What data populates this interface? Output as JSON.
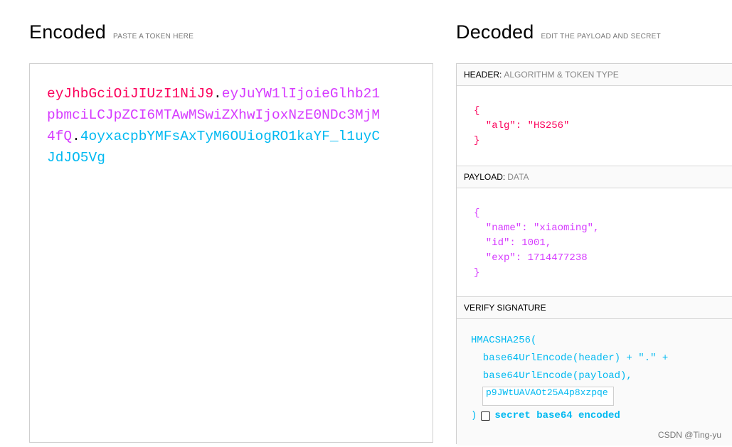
{
  "encoded": {
    "title": "Encoded",
    "subtitle": "PASTE A TOKEN HERE",
    "token": {
      "header": "eyJhbGciOiJIUzI1NiJ9",
      "payload": "eyJuYW1lIjoieGlhb21pbmciLCJpZCI6MTAwMSwiZXhwIjoxNzE0NDc3MjM4fQ",
      "signature": "4oyxacpbYMFsAxTyM6OUiogRO1kaYF_l1uyCJdJO5Vg",
      "dot": "."
    }
  },
  "decoded": {
    "title": "Decoded",
    "subtitle": "EDIT THE PAYLOAD AND SECRET",
    "header_section": {
      "label": "HEADER:",
      "sublabel": "ALGORITHM & TOKEN TYPE",
      "lines": [
        "{",
        "  \"alg\": \"HS256\"",
        "}"
      ]
    },
    "payload_section": {
      "label": "PAYLOAD:",
      "sublabel": "DATA",
      "lines": [
        "{",
        "  \"name\": \"xiaoming\",",
        "  \"id\": 1001,",
        "  \"exp\": 1714477238",
        "}"
      ]
    },
    "signature_section": {
      "label": "VERIFY SIGNATURE",
      "line1": "HMACSHA256(",
      "line2": "  base64UrlEncode(header) + \".\" +",
      "line3": "  base64UrlEncode(payload),",
      "secret_value": "p9JWtUAVAOt25A4p8xzpqe",
      "close": ")",
      "base64_label": "secret base64 encoded",
      "base64_checked": false
    }
  },
  "watermark": "CSDN @Ting-yu",
  "colors": {
    "header": "#fb015b",
    "payload": "#d63aff",
    "signature": "#00b9f1"
  }
}
